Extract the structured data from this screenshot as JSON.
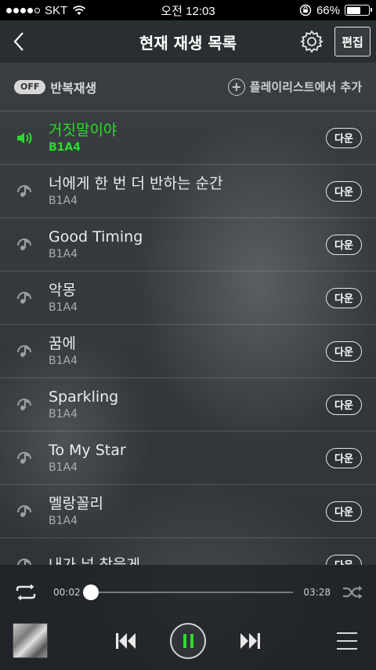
{
  "status_bar": {
    "carrier": "SKT",
    "time": "오전 12:03",
    "battery_percent": "66%",
    "battery_level": 0.66
  },
  "header": {
    "title": "현재 재생 목록",
    "edit_label": "편집"
  },
  "toolbar": {
    "repeat_badge": "OFF",
    "repeat_label": "반복재생",
    "add_label": "플레이리스트에서 추가"
  },
  "tracks": [
    {
      "title": "거짓말이야",
      "artist": "B1A4",
      "down": "다운",
      "active": true
    },
    {
      "title": "너에게 한 번 더 반하는 순간",
      "artist": "B1A4",
      "down": "다운"
    },
    {
      "title": "Good Timing",
      "artist": "B1A4",
      "down": "다운"
    },
    {
      "title": "악몽",
      "artist": "B1A4",
      "down": "다운"
    },
    {
      "title": "꿈에",
      "artist": "B1A4",
      "down": "다운"
    },
    {
      "title": "Sparkling",
      "artist": "B1A4",
      "down": "다운"
    },
    {
      "title": "To My Star",
      "artist": "B1A4",
      "down": "다운"
    },
    {
      "title": "멜랑꼴리",
      "artist": "B1A4",
      "down": "다운"
    },
    {
      "title": "내가 널 찾을게",
      "artist": "",
      "down": "다운"
    }
  ],
  "player": {
    "current_time": "00:02",
    "total_time": "03:28",
    "progress": 0.0,
    "playing": true
  },
  "colors": {
    "accent": "#2bdc2b"
  }
}
